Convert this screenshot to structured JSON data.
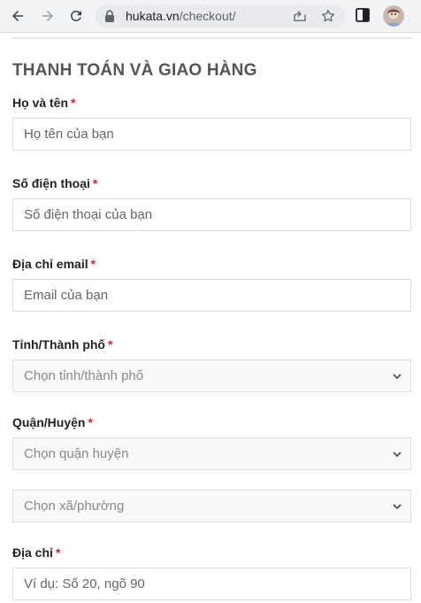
{
  "browser": {
    "url_domain": "hukata.vn",
    "url_path": "/checkout/"
  },
  "icons": {
    "back": "arrow-left-icon",
    "forward": "arrow-right-icon",
    "reload": "reload-icon",
    "lock": "lock-icon",
    "share": "share-icon",
    "star": "star-icon",
    "sidebar": "side-panel-icon",
    "avatar": "profile-avatar"
  },
  "colors": {
    "required": "#e0202f",
    "border": "#dddddd",
    "select_bg": "#f9f9f9"
  },
  "form": {
    "title": "THANH TOÁN VÀ GIAO HÀNG",
    "required_mark": "*",
    "name": {
      "label": "Họ và tên",
      "placeholder": "Họ tên của bạn"
    },
    "phone": {
      "label": "Số điện thoại",
      "placeholder": "Số điện thoại của bạn"
    },
    "email": {
      "label": "Địa chỉ email",
      "placeholder": "Email của bạn"
    },
    "province": {
      "label": "Tỉnh/Thành phố",
      "value": "Chọn tỉnh/thành phố"
    },
    "district": {
      "label": "Quận/Huyện",
      "value": "Chọn quận huyện"
    },
    "ward": {
      "value": "Chọn xã/phường"
    },
    "address": {
      "label": "Địa chỉ",
      "placeholder": "Ví dụ: Số 20, ngõ 90"
    }
  }
}
